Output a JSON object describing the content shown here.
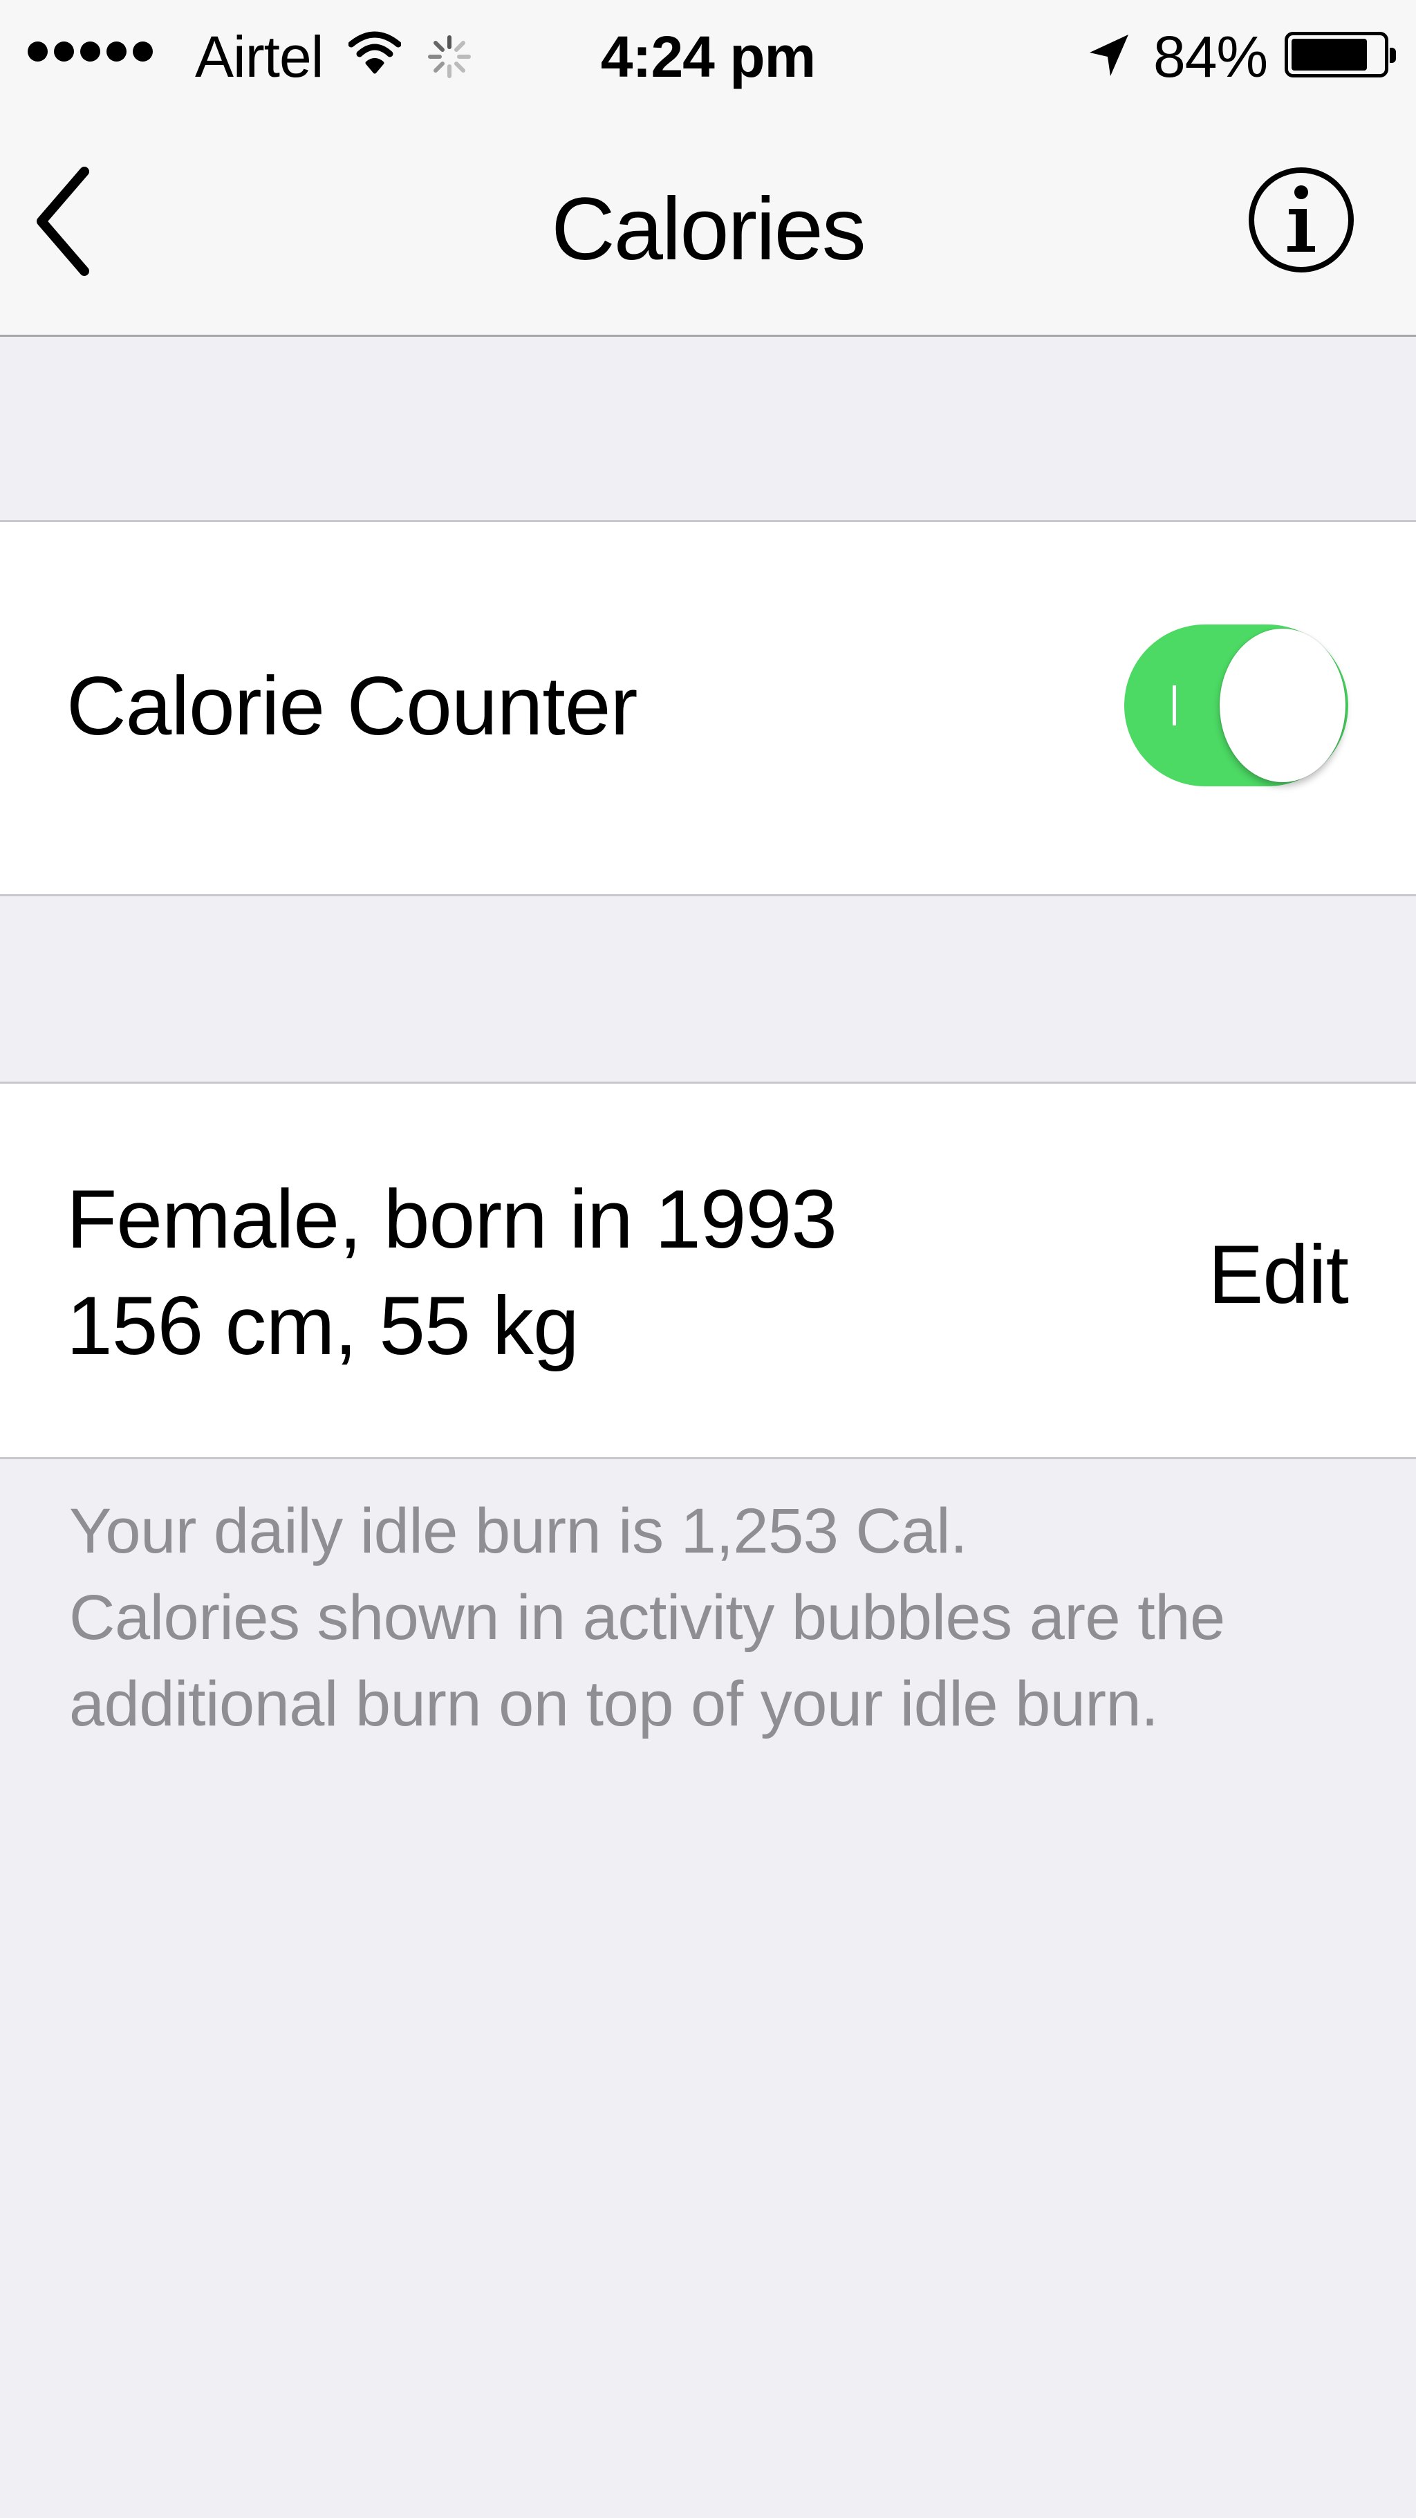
{
  "status_bar": {
    "carrier": "Airtel",
    "time": "4:24 pm",
    "battery_percent": "84%",
    "battery_level": 0.84,
    "signal_dots": 5,
    "icons": [
      "signal-dots-icon",
      "wifi-icon",
      "activity-spinner-icon",
      "location-arrow-icon",
      "battery-icon"
    ]
  },
  "nav": {
    "title": "Calories",
    "back_icon": "chevron-left-icon",
    "info_icon": "info-circle-icon"
  },
  "calorie_counter": {
    "label": "Calorie Counter",
    "enabled": true,
    "toggle_color": "#4cd964"
  },
  "profile": {
    "line1": "Female, born in 1993",
    "line2": "156 cm, 55 kg",
    "edit_label": "Edit"
  },
  "footnote": {
    "line1": "Your daily idle burn is 1,253 Cal.",
    "line2": "Calories shown in activity bubbles are the",
    "line3": "additional burn on top of your idle burn."
  },
  "colors": {
    "background": "#efeff4",
    "bar": "#f7f7f7",
    "secondary_text": "#8e8e93"
  }
}
